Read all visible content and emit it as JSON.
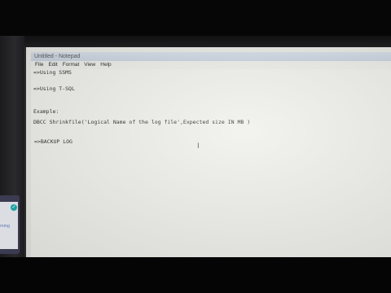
{
  "window": {
    "title": "Untitled - Notepad"
  },
  "menu": [
    "File",
    "Edit",
    "Format",
    "View",
    "Help"
  ],
  "document": {
    "lines": [
      "=>Using SSMS",
      "=>Using T-SQL",
      "Example:",
      "DBCC Shrinkfile('Logical Name of the log file',Expected size IN MB )",
      "=>BACKUP LOG"
    ]
  },
  "cursor_glyph": "I",
  "side_panel": {
    "badge_icon": "check-icon",
    "badge_glyph": "✓",
    "label": "ming"
  }
}
